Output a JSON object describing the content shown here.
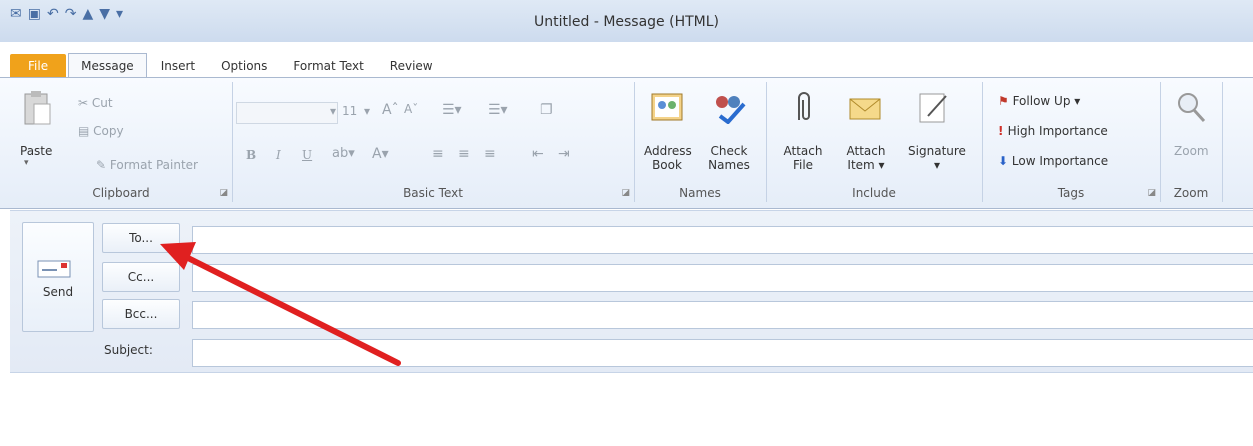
{
  "window": {
    "title": "Untitled  -  Message (HTML)"
  },
  "quick_access": [
    "outlook-icon",
    "save-icon",
    "undo-icon",
    "redo-icon",
    "up-icon",
    "down-icon",
    "customize-icon"
  ],
  "tabs": [
    "File",
    "Message",
    "Insert",
    "Options",
    "Format Text",
    "Review"
  ],
  "ribbon": {
    "clipboard": {
      "label": "Clipboard",
      "paste": "Paste",
      "cut": "Cut",
      "copy": "Copy",
      "format_painter": "Format Painter"
    },
    "basic_text": {
      "label": "Basic Text",
      "font_size": "11"
    },
    "names": {
      "label": "Names",
      "address_book_1": "Address",
      "address_book_2": "Book",
      "check_names_1": "Check",
      "check_names_2": "Names"
    },
    "include": {
      "label": "Include",
      "attach_file_1": "Attach",
      "attach_file_2": "File",
      "attach_item_1": "Attach",
      "attach_item_2": "Item",
      "signature": "Signature"
    },
    "tags": {
      "label": "Tags",
      "follow_up": "Follow Up",
      "high": "High Importance",
      "low": "Low Importance"
    },
    "zoom": {
      "label": "Zoom",
      "zoom": "Zoom"
    }
  },
  "compose": {
    "send": "Send",
    "to": "To...",
    "cc": "Cc...",
    "bcc": "Bcc...",
    "subject": "Subject:"
  },
  "colors": {
    "accent": "#f0a21b",
    "arrow": "#e02020"
  }
}
